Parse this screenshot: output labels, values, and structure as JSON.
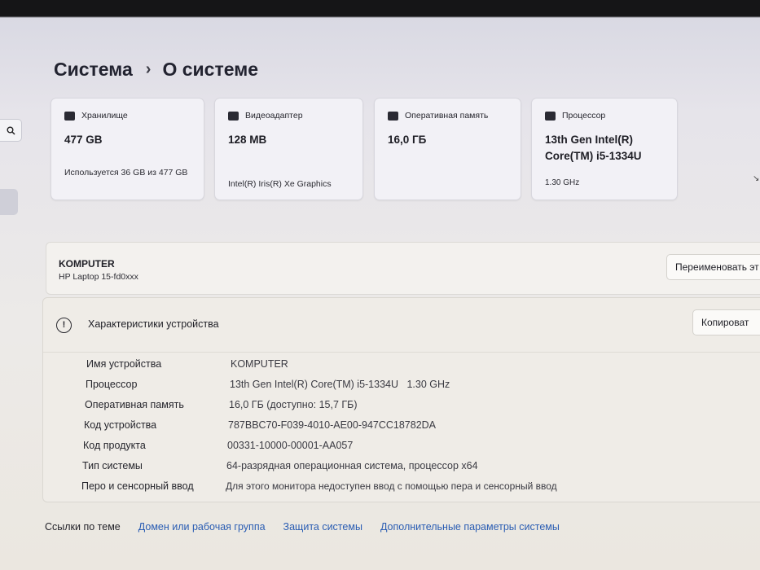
{
  "header": {
    "crumb_parent": "Система",
    "crumb_separator": "›",
    "crumb_current": "О системе"
  },
  "cards": [
    {
      "icon": "storage-icon",
      "label": "Хранилище",
      "value": "477 GB",
      "sub": "Используется 36 GB из 477 GB"
    },
    {
      "icon": "display-adapter-icon",
      "label": "Видеоадаптер",
      "value": "128 MB",
      "sub": "Intel(R) Iris(R) Xe Graphics"
    },
    {
      "icon": "memory-icon",
      "label": "Оперативная память",
      "value": "16,0 ГБ",
      "sub": ""
    },
    {
      "icon": "processor-icon",
      "label": "Процессор",
      "value": "13th Gen Intel(R) Core(TM) i5-1334U",
      "sub": "1.30 GHz"
    }
  ],
  "device": {
    "name": "KOMPUTER",
    "model": "HP Laptop 15-fd0xxx",
    "rename_label": "Переименовать эт"
  },
  "specs": {
    "title": "Характеристики устройства",
    "copy_label": "Копироват",
    "rows": [
      {
        "key": "Имя устройства",
        "value": "KOMPUTER"
      },
      {
        "key": "Процессор",
        "value": "13th Gen Intel(R) Core(TM) i5-1334U   1.30 GHz"
      },
      {
        "key": "Оперативная память",
        "value": "16,0 ГБ (доступно: 15,7 ГБ)"
      },
      {
        "key": "Код устройства",
        "value": "787BBC70-F039-4010-AE00-947CC18782DA"
      },
      {
        "key": "Код продукта",
        "value": "00331-10000-00001-AA057"
      },
      {
        "key": "Тип системы",
        "value": "64-разрядная операционная система, процессор x64"
      },
      {
        "key": "Перо и сенсорный ввод",
        "value": "Для этого монитора недоступен ввод с помощью пера и сенсорный ввод"
      }
    ]
  },
  "related": {
    "label": "Ссылки по теме",
    "links": [
      "Домен или рабочая группа",
      "Защита системы",
      "Дополнительные параметры системы"
    ]
  },
  "sidebar": {
    "search_icon": "search-icon"
  }
}
